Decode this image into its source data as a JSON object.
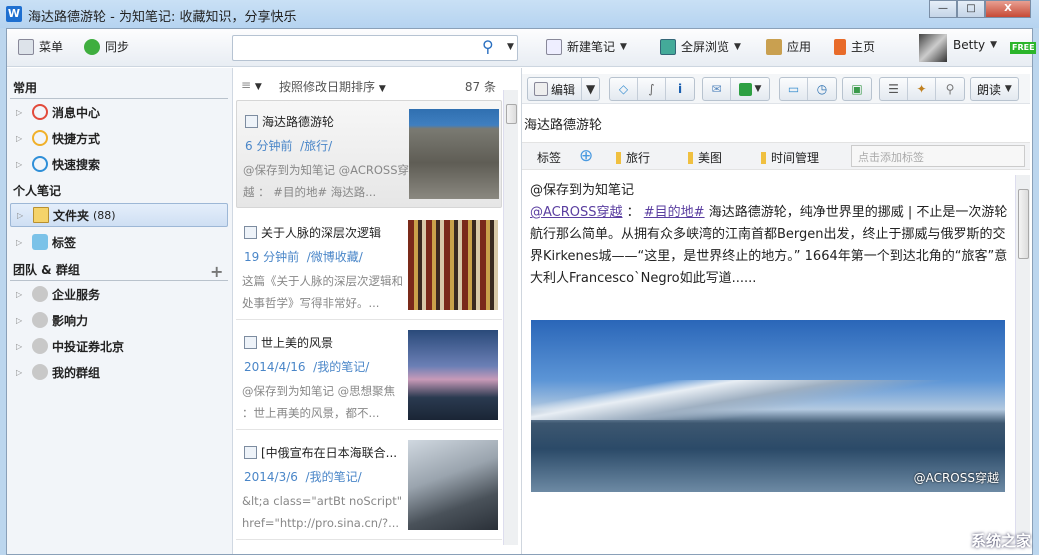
{
  "window": {
    "title": "海达路德游轮 - 为知笔记: 收藏知识，分享快乐",
    "app_icon": "W",
    "minimize": "—",
    "maximize": "□",
    "close": "X"
  },
  "toolbar": {
    "menu": "菜单",
    "sync": "同步",
    "search_placeholder": "",
    "new_note": "新建笔记",
    "fullscreen": "全屏浏览",
    "apps": "应用",
    "home": "主页",
    "user": "Betty",
    "badge": "FREE"
  },
  "sidebar": {
    "sections": [
      {
        "label": "常用",
        "items": [
          {
            "label": "消息中心",
            "color": "#e24a3b"
          },
          {
            "label": "快捷方式",
            "color": "#f0b02a"
          },
          {
            "label": "快速搜索",
            "color": "#2f8fd8"
          }
        ]
      },
      {
        "label": "个人笔记",
        "items": [
          {
            "label": "文件夹",
            "count": "(88)"
          },
          {
            "label": "标签"
          }
        ]
      },
      {
        "label": "团队 & 群组",
        "add": "+",
        "items": [
          {
            "label": "企业服务"
          },
          {
            "label": "影响力"
          },
          {
            "label": "中投证券北京"
          },
          {
            "label": "我的群组"
          }
        ]
      }
    ]
  },
  "notelist": {
    "sort_label": "按照修改日期排序",
    "count": "87 条",
    "notes": [
      {
        "title": "海达路德游轮",
        "time": "6 分钟前",
        "folder": "/旅行/",
        "summary": "@保存到为知笔记 @ACROSS穿越 ： #目的地# 海达路..."
      },
      {
        "title": "关于人脉的深层次逻辑",
        "time": "19 分钟前",
        "folder": "/微博收藏/",
        "summary": "这篇《关于人脉的深层次逻辑和处事哲学》写得非常好。..."
      },
      {
        "title": "世上美的风景",
        "time": "2014/4/16",
        "folder": "/我的笔记/",
        "summary": "@保存到为知笔记 @思想聚焦 ：世上再美的风景，都不..."
      },
      {
        "title": "[中俄宣布在日本海联合...",
        "time": "2014/3/6",
        "folder": "/我的笔记/",
        "summary": "&lt;a class=\"artBt noScript\" href=\"http://pro.sina.cn/?..."
      }
    ]
  },
  "editor": {
    "edit": "编辑",
    "read": "朗读",
    "title": "海达路德游轮",
    "tags_label": "标签",
    "tags": [
      "旅行",
      "美图",
      "时间管理"
    ],
    "tag_placeholder": "点击添加标签",
    "content": {
      "line1": "@保存到为知笔记",
      "mention": "@ACROSS穿越",
      "sep": " ： ",
      "hashtag": "#目的地#",
      "body": " 海达路德游轮，纯净世界里的挪威 | 不止是一次游轮航行那么简单。从拥有众多峡湾的江南首都Bergen出发，终止于挪威与俄罗斯的交界Kirkenes城——“这里，是世界终止的地方。” 1664年第一个到达北角的“旅客”意大利人Francesco`Negro如此写道......"
    },
    "image_caption": "@ACROSS穿越"
  },
  "watermark": "系统之家"
}
